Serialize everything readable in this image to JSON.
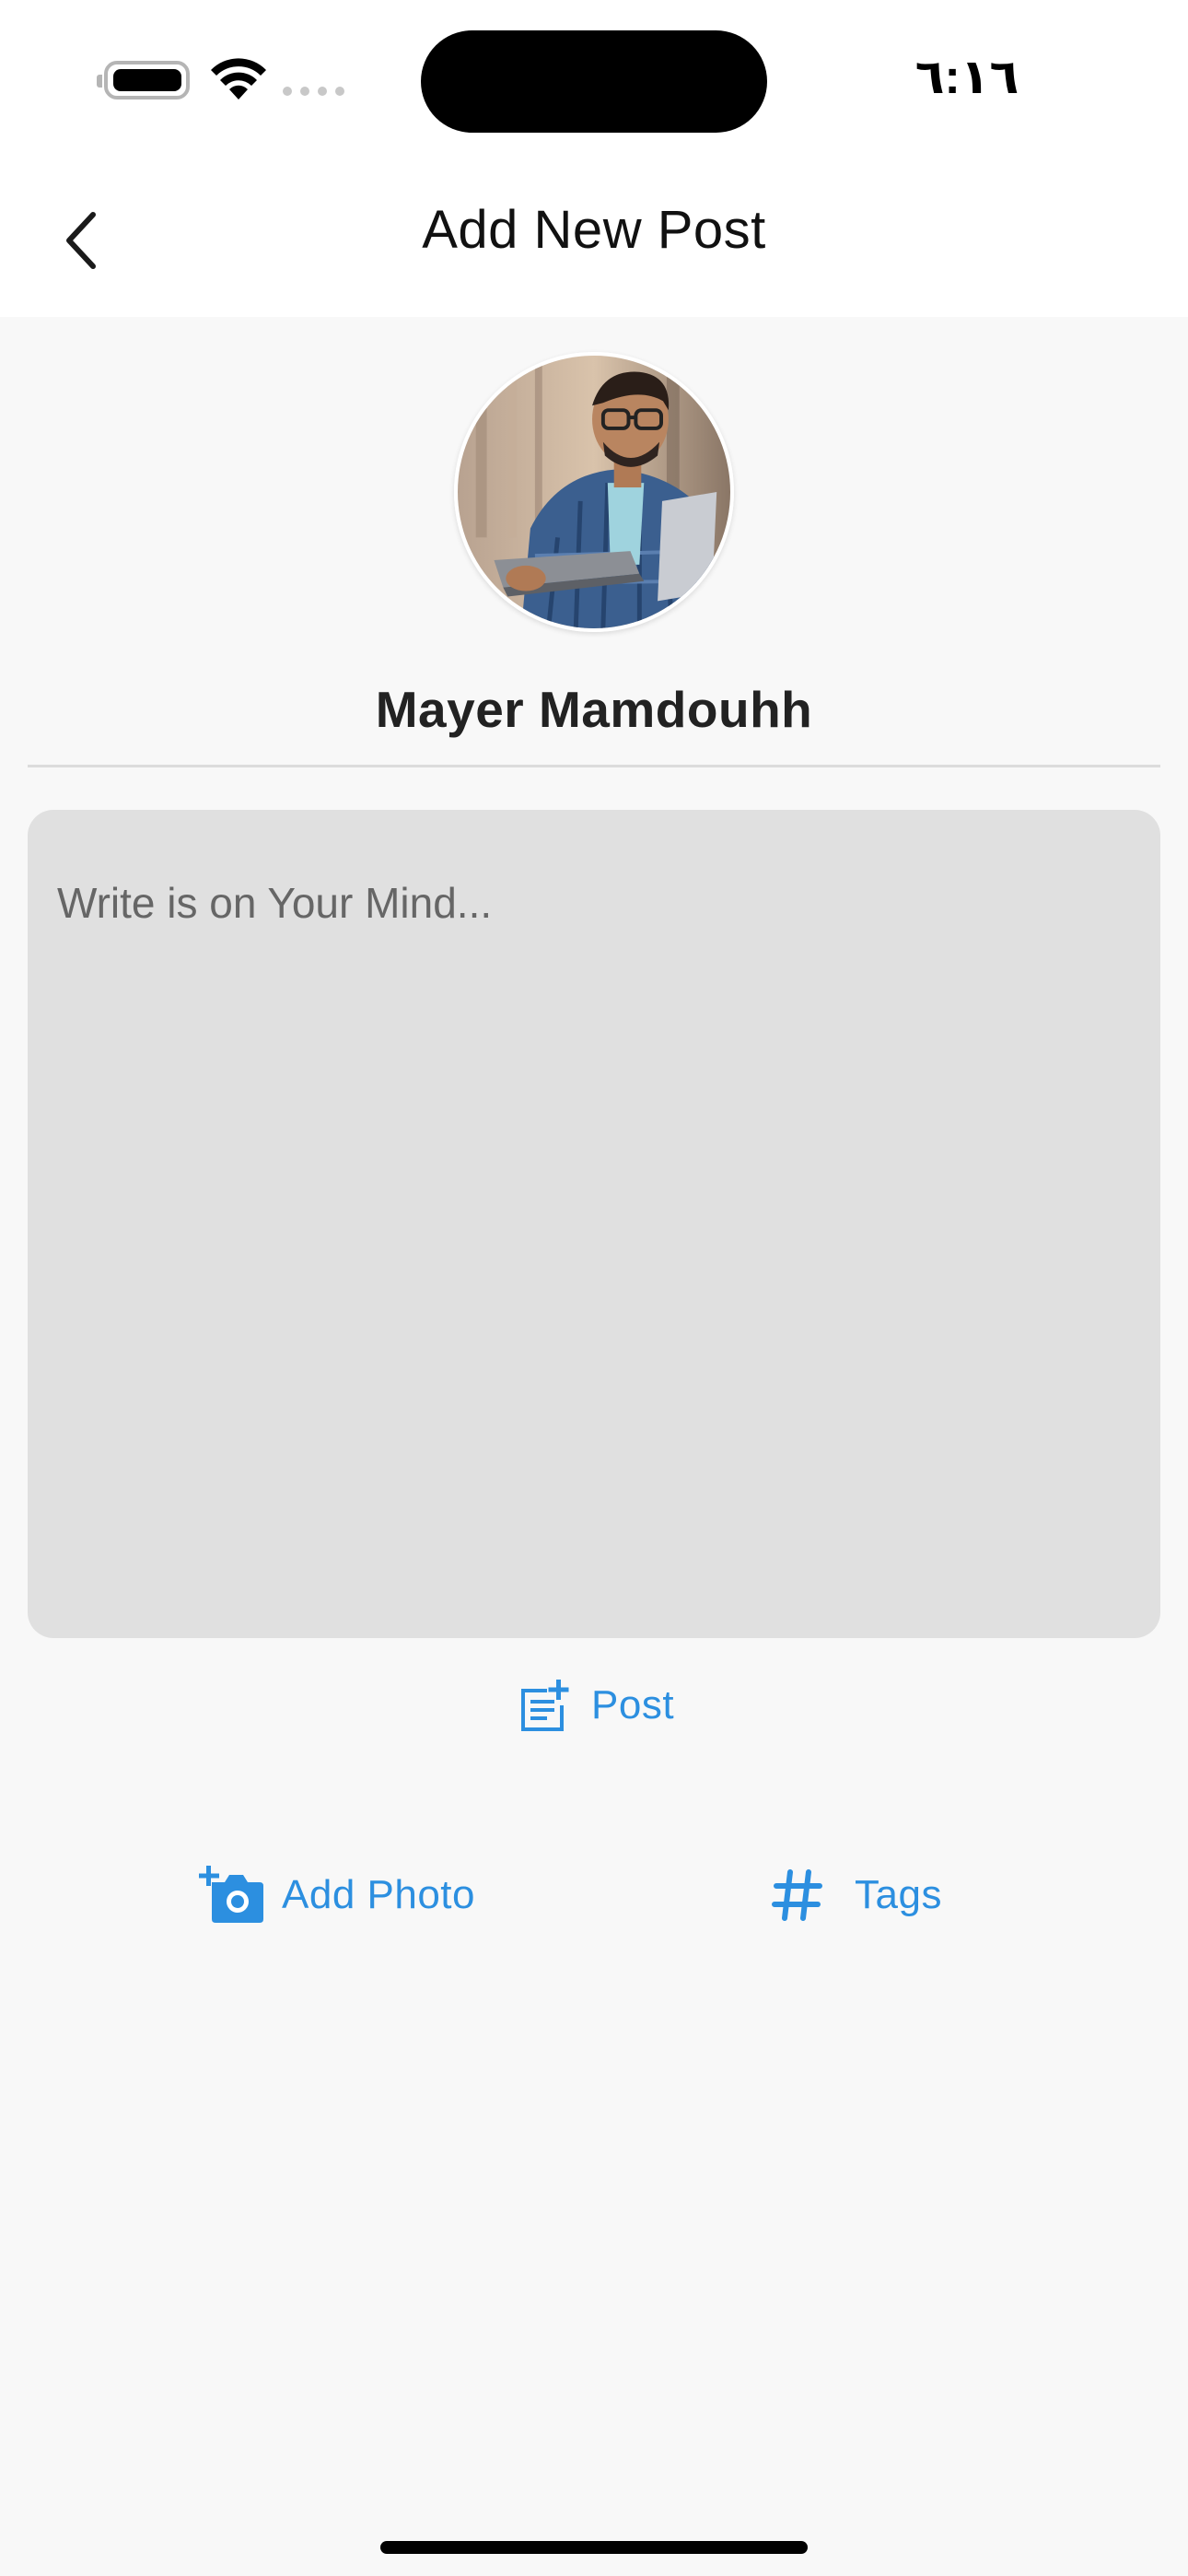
{
  "status_bar": {
    "time": "٦:١٦",
    "battery_icon": "battery-icon",
    "wifi_icon": "wifi-icon",
    "signal_icon": "cellular-signal-icon"
  },
  "header": {
    "title": "Add New Post",
    "back_icon": "chevron-left-icon"
  },
  "profile": {
    "name": "Mayer Mamdouhh",
    "avatar_icon": "user-avatar"
  },
  "composer": {
    "placeholder": "Write is on Your Mind...",
    "value": ""
  },
  "actions": {
    "post_label": "Post",
    "post_icon": "post-add-icon",
    "add_photo_label": "Add Photo",
    "add_photo_icon": "add-camera-icon",
    "tags_label": "Tags",
    "tags_icon": "hashtag-icon"
  },
  "colors": {
    "accent": "#2c8fe0",
    "background": "#f8f8f8",
    "input_background": "#e0e0e0",
    "header_background": "#ffffff"
  }
}
